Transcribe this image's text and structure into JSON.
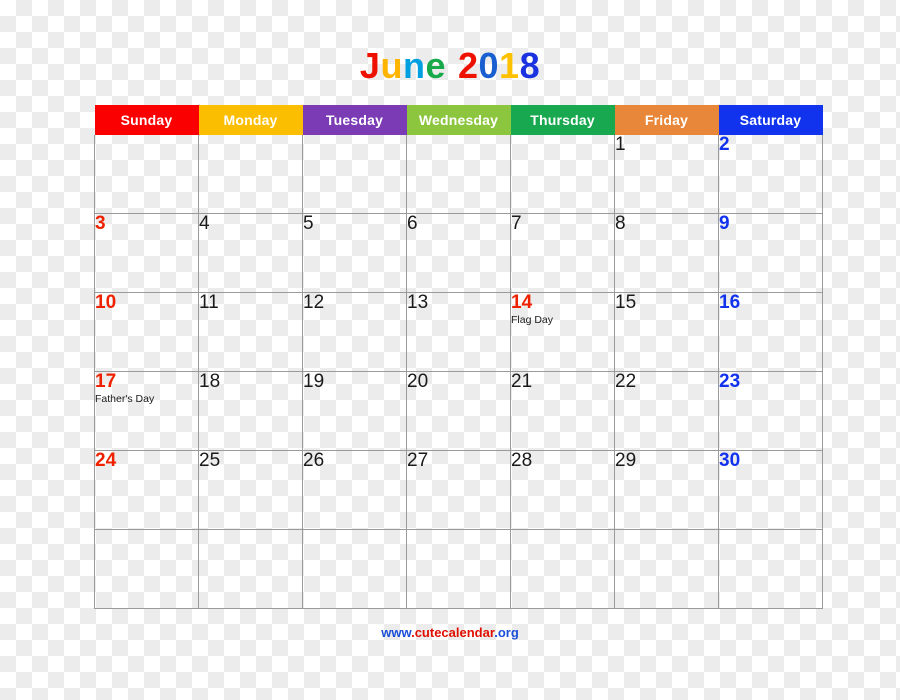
{
  "title": {
    "text": "June 2018",
    "letters": [
      {
        "ch": "J",
        "color": "#ee1100"
      },
      {
        "ch": "u",
        "color": "#ffb400"
      },
      {
        "ch": "n",
        "color": "#00a0e0"
      },
      {
        "ch": "e",
        "color": "#18aa4a"
      },
      {
        "ch": " ",
        "color": "#000000"
      },
      {
        "ch": "2",
        "color": "#ee1100"
      },
      {
        "ch": "0",
        "color": "#1a5fd0"
      },
      {
        "ch": "1",
        "color": "#ffc000"
      },
      {
        "ch": "8",
        "color": "#1a32e0"
      }
    ]
  },
  "header": {
    "days": [
      {
        "label": "Sunday",
        "color": "#fa0000"
      },
      {
        "label": "Monday",
        "color": "#fbbe00"
      },
      {
        "label": "Tuesday",
        "color": "#7b3bb5"
      },
      {
        "label": "Wednesday",
        "color": "#8cc63f"
      },
      {
        "label": "Thursday",
        "color": "#18a84f"
      },
      {
        "label": "Friday",
        "color": "#e8873a"
      },
      {
        "label": "Saturday",
        "color": "#1133ee"
      }
    ]
  },
  "weeks": [
    [
      {
        "date": "",
        "event": "",
        "kind": "empty"
      },
      {
        "date": "",
        "event": "",
        "kind": "empty"
      },
      {
        "date": "",
        "event": "",
        "kind": "empty"
      },
      {
        "date": "",
        "event": "",
        "kind": "empty"
      },
      {
        "date": "",
        "event": "",
        "kind": "empty"
      },
      {
        "date": "1",
        "event": "",
        "kind": "weekday"
      },
      {
        "date": "2",
        "event": "",
        "kind": "saturday"
      }
    ],
    [
      {
        "date": "3",
        "event": "",
        "kind": "sunday"
      },
      {
        "date": "4",
        "event": "",
        "kind": "weekday"
      },
      {
        "date": "5",
        "event": "",
        "kind": "weekday"
      },
      {
        "date": "6",
        "event": "",
        "kind": "weekday"
      },
      {
        "date": "7",
        "event": "",
        "kind": "weekday"
      },
      {
        "date": "8",
        "event": "",
        "kind": "weekday"
      },
      {
        "date": "9",
        "event": "",
        "kind": "saturday"
      }
    ],
    [
      {
        "date": "10",
        "event": "",
        "kind": "sunday"
      },
      {
        "date": "11",
        "event": "",
        "kind": "weekday"
      },
      {
        "date": "12",
        "event": "",
        "kind": "weekday"
      },
      {
        "date": "13",
        "event": "",
        "kind": "weekday"
      },
      {
        "date": "14",
        "event": "Flag Day",
        "kind": "holiday"
      },
      {
        "date": "15",
        "event": "",
        "kind": "weekday"
      },
      {
        "date": "16",
        "event": "",
        "kind": "saturday"
      }
    ],
    [
      {
        "date": "17",
        "event": "Father's Day",
        "kind": "sunday"
      },
      {
        "date": "18",
        "event": "",
        "kind": "weekday"
      },
      {
        "date": "19",
        "event": "",
        "kind": "weekday"
      },
      {
        "date": "20",
        "event": "",
        "kind": "weekday"
      },
      {
        "date": "21",
        "event": "",
        "kind": "weekday"
      },
      {
        "date": "22",
        "event": "",
        "kind": "weekday"
      },
      {
        "date": "23",
        "event": "",
        "kind": "saturday"
      }
    ],
    [
      {
        "date": "24",
        "event": "",
        "kind": "sunday"
      },
      {
        "date": "25",
        "event": "",
        "kind": "weekday"
      },
      {
        "date": "26",
        "event": "",
        "kind": "weekday"
      },
      {
        "date": "27",
        "event": "",
        "kind": "weekday"
      },
      {
        "date": "28",
        "event": "",
        "kind": "weekday"
      },
      {
        "date": "29",
        "event": "",
        "kind": "weekday"
      },
      {
        "date": "30",
        "event": "",
        "kind": "saturday"
      }
    ],
    [
      {
        "date": "",
        "event": "",
        "kind": "empty"
      },
      {
        "date": "",
        "event": "",
        "kind": "empty"
      },
      {
        "date": "",
        "event": "",
        "kind": "empty"
      },
      {
        "date": "",
        "event": "",
        "kind": "empty"
      },
      {
        "date": "",
        "event": "",
        "kind": "empty"
      },
      {
        "date": "",
        "event": "",
        "kind": "empty"
      },
      {
        "date": "",
        "event": "",
        "kind": "empty"
      }
    ]
  ],
  "footer": {
    "url": "www.cutecalendar.org",
    "segments": [
      {
        "text": "www",
        "color": "#1a4fd8"
      },
      {
        "text": ".",
        "color": "#e01000"
      },
      {
        "text": "cutecalendar",
        "color": "#e01000"
      },
      {
        "text": ".",
        "color": "#1a4fd8"
      },
      {
        "text": "org",
        "color": "#1a4fd8"
      }
    ]
  },
  "colors": {
    "sunday_red": "#ee2200",
    "saturday_blue": "#1133ee",
    "weekday_black": "#1a1a1a",
    "grid_line": "#9a9a9a"
  }
}
